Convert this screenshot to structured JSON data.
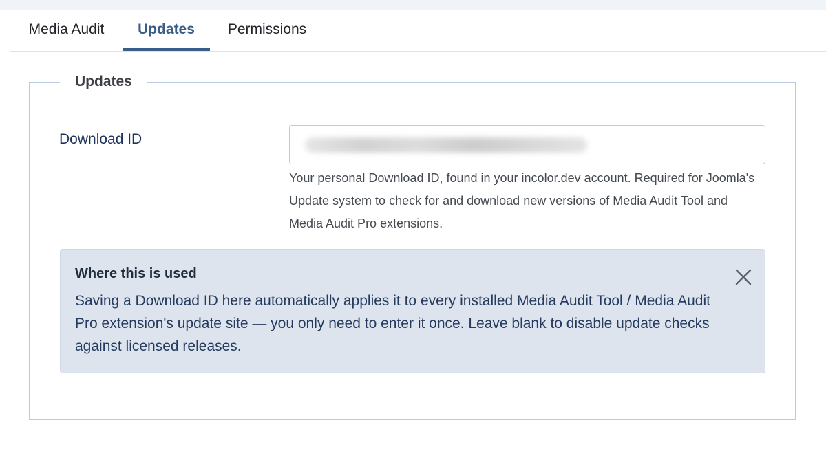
{
  "tabs": [
    {
      "label": "Media Audit",
      "active": false
    },
    {
      "label": "Updates",
      "active": true
    },
    {
      "label": "Permissions",
      "active": false
    }
  ],
  "colors": {
    "accent": "#3b5e88",
    "label_text": "#1e3359",
    "alert_background": "#dde4ee",
    "border": "#b9cde2"
  },
  "fieldset": {
    "legend": "Updates",
    "download_id": {
      "label": "Download ID",
      "value_obscured": true,
      "help": "Your personal Download ID, found in your incolor.dev account. Required for Joomla's Update system to check for and download new versions of Media Audit Tool and Media Audit Pro extensions."
    }
  },
  "alert": {
    "title": "Where this is used",
    "text": "Saving a Download ID here automatically applies it to every installed Media Audit Tool / Media Audit Pro extension's update site — you only need to enter it once. Leave blank to disable update checks against licensed releases.",
    "close_icon": "close-icon"
  }
}
